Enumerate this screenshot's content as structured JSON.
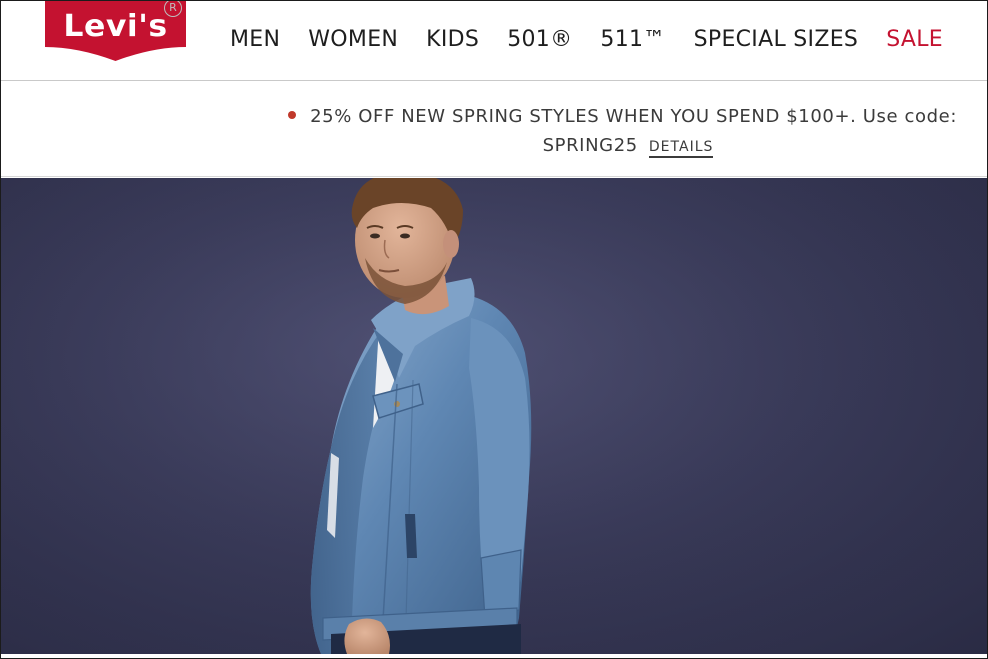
{
  "header": {
    "logo_text": "Levi's",
    "registered_symbol": "R",
    "nav": [
      {
        "label": "MEN"
      },
      {
        "label": "WOMEN"
      },
      {
        "label": "KIDS"
      },
      {
        "label": "501®"
      },
      {
        "label": "511™"
      },
      {
        "label": "SPECIAL SIZES"
      },
      {
        "label": "SALE"
      }
    ]
  },
  "promo": {
    "headline": "25% OFF NEW SPRING STYLES WHEN YOU SPEND $100+. Use code:",
    "code": "SPRING25",
    "details_link": "DETAILS"
  },
  "colors": {
    "brand_red": "#c41230",
    "promo_dot": "#c0392b",
    "hero_background": "#3a3b5a",
    "denim": "#5e84ad"
  }
}
